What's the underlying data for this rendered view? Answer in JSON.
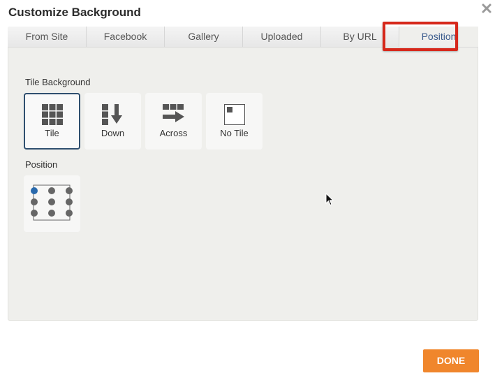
{
  "dialog": {
    "title": "Customize Background",
    "close_icon": "close-icon"
  },
  "tabs": [
    {
      "label": "From Site"
    },
    {
      "label": "Facebook"
    },
    {
      "label": "Gallery"
    },
    {
      "label": "Uploaded"
    },
    {
      "label": "By URL"
    },
    {
      "label": "Position",
      "active": true
    }
  ],
  "tile_background": {
    "label": "Tile Background",
    "options": [
      {
        "label": "Tile",
        "icon": "grid-tile-icon",
        "selected": true
      },
      {
        "label": "Down",
        "icon": "tile-down-icon"
      },
      {
        "label": "Across",
        "icon": "tile-across-icon"
      },
      {
        "label": "No Tile",
        "icon": "no-tile-icon"
      }
    ]
  },
  "position": {
    "label": "Position",
    "selected": "top-left",
    "colors": {
      "selected_dot": "#2a6aad",
      "dot": "#666666"
    }
  },
  "footer": {
    "done_label": "DONE"
  },
  "colors": {
    "accent": "#f0862c",
    "highlight": "#d6281b",
    "active_tab_text": "#3b5b8c"
  }
}
